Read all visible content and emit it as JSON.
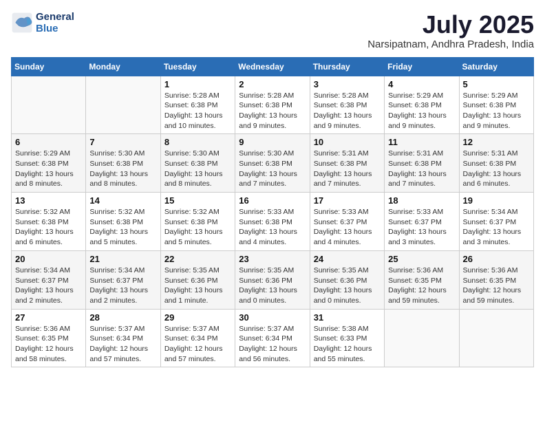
{
  "logo": {
    "line1": "General",
    "line2": "Blue"
  },
  "title": "July 2025",
  "subtitle": "Narsipatnam, Andhra Pradesh, India",
  "days_header": [
    "Sunday",
    "Monday",
    "Tuesday",
    "Wednesday",
    "Thursday",
    "Friday",
    "Saturday"
  ],
  "weeks": [
    [
      {
        "day": "",
        "info": ""
      },
      {
        "day": "",
        "info": ""
      },
      {
        "day": "1",
        "info": "Sunrise: 5:28 AM\nSunset: 6:38 PM\nDaylight: 13 hours\nand 10 minutes."
      },
      {
        "day": "2",
        "info": "Sunrise: 5:28 AM\nSunset: 6:38 PM\nDaylight: 13 hours\nand 9 minutes."
      },
      {
        "day": "3",
        "info": "Sunrise: 5:28 AM\nSunset: 6:38 PM\nDaylight: 13 hours\nand 9 minutes."
      },
      {
        "day": "4",
        "info": "Sunrise: 5:29 AM\nSunset: 6:38 PM\nDaylight: 13 hours\nand 9 minutes."
      },
      {
        "day": "5",
        "info": "Sunrise: 5:29 AM\nSunset: 6:38 PM\nDaylight: 13 hours\nand 9 minutes."
      }
    ],
    [
      {
        "day": "6",
        "info": "Sunrise: 5:29 AM\nSunset: 6:38 PM\nDaylight: 13 hours\nand 8 minutes."
      },
      {
        "day": "7",
        "info": "Sunrise: 5:30 AM\nSunset: 6:38 PM\nDaylight: 13 hours\nand 8 minutes."
      },
      {
        "day": "8",
        "info": "Sunrise: 5:30 AM\nSunset: 6:38 PM\nDaylight: 13 hours\nand 8 minutes."
      },
      {
        "day": "9",
        "info": "Sunrise: 5:30 AM\nSunset: 6:38 PM\nDaylight: 13 hours\nand 7 minutes."
      },
      {
        "day": "10",
        "info": "Sunrise: 5:31 AM\nSunset: 6:38 PM\nDaylight: 13 hours\nand 7 minutes."
      },
      {
        "day": "11",
        "info": "Sunrise: 5:31 AM\nSunset: 6:38 PM\nDaylight: 13 hours\nand 7 minutes."
      },
      {
        "day": "12",
        "info": "Sunrise: 5:31 AM\nSunset: 6:38 PM\nDaylight: 13 hours\nand 6 minutes."
      }
    ],
    [
      {
        "day": "13",
        "info": "Sunrise: 5:32 AM\nSunset: 6:38 PM\nDaylight: 13 hours\nand 6 minutes."
      },
      {
        "day": "14",
        "info": "Sunrise: 5:32 AM\nSunset: 6:38 PM\nDaylight: 13 hours\nand 5 minutes."
      },
      {
        "day": "15",
        "info": "Sunrise: 5:32 AM\nSunset: 6:38 PM\nDaylight: 13 hours\nand 5 minutes."
      },
      {
        "day": "16",
        "info": "Sunrise: 5:33 AM\nSunset: 6:38 PM\nDaylight: 13 hours\nand 4 minutes."
      },
      {
        "day": "17",
        "info": "Sunrise: 5:33 AM\nSunset: 6:37 PM\nDaylight: 13 hours\nand 4 minutes."
      },
      {
        "day": "18",
        "info": "Sunrise: 5:33 AM\nSunset: 6:37 PM\nDaylight: 13 hours\nand 3 minutes."
      },
      {
        "day": "19",
        "info": "Sunrise: 5:34 AM\nSunset: 6:37 PM\nDaylight: 13 hours\nand 3 minutes."
      }
    ],
    [
      {
        "day": "20",
        "info": "Sunrise: 5:34 AM\nSunset: 6:37 PM\nDaylight: 13 hours\nand 2 minutes."
      },
      {
        "day": "21",
        "info": "Sunrise: 5:34 AM\nSunset: 6:37 PM\nDaylight: 13 hours\nand 2 minutes."
      },
      {
        "day": "22",
        "info": "Sunrise: 5:35 AM\nSunset: 6:36 PM\nDaylight: 13 hours\nand 1 minute."
      },
      {
        "day": "23",
        "info": "Sunrise: 5:35 AM\nSunset: 6:36 PM\nDaylight: 13 hours\nand 0 minutes."
      },
      {
        "day": "24",
        "info": "Sunrise: 5:35 AM\nSunset: 6:36 PM\nDaylight: 13 hours\nand 0 minutes."
      },
      {
        "day": "25",
        "info": "Sunrise: 5:36 AM\nSunset: 6:35 PM\nDaylight: 12 hours\nand 59 minutes."
      },
      {
        "day": "26",
        "info": "Sunrise: 5:36 AM\nSunset: 6:35 PM\nDaylight: 12 hours\nand 59 minutes."
      }
    ],
    [
      {
        "day": "27",
        "info": "Sunrise: 5:36 AM\nSunset: 6:35 PM\nDaylight: 12 hours\nand 58 minutes."
      },
      {
        "day": "28",
        "info": "Sunrise: 5:37 AM\nSunset: 6:34 PM\nDaylight: 12 hours\nand 57 minutes."
      },
      {
        "day": "29",
        "info": "Sunrise: 5:37 AM\nSunset: 6:34 PM\nDaylight: 12 hours\nand 57 minutes."
      },
      {
        "day": "30",
        "info": "Sunrise: 5:37 AM\nSunset: 6:34 PM\nDaylight: 12 hours\nand 56 minutes."
      },
      {
        "day": "31",
        "info": "Sunrise: 5:38 AM\nSunset: 6:33 PM\nDaylight: 12 hours\nand 55 minutes."
      },
      {
        "day": "",
        "info": ""
      },
      {
        "day": "",
        "info": ""
      }
    ]
  ]
}
